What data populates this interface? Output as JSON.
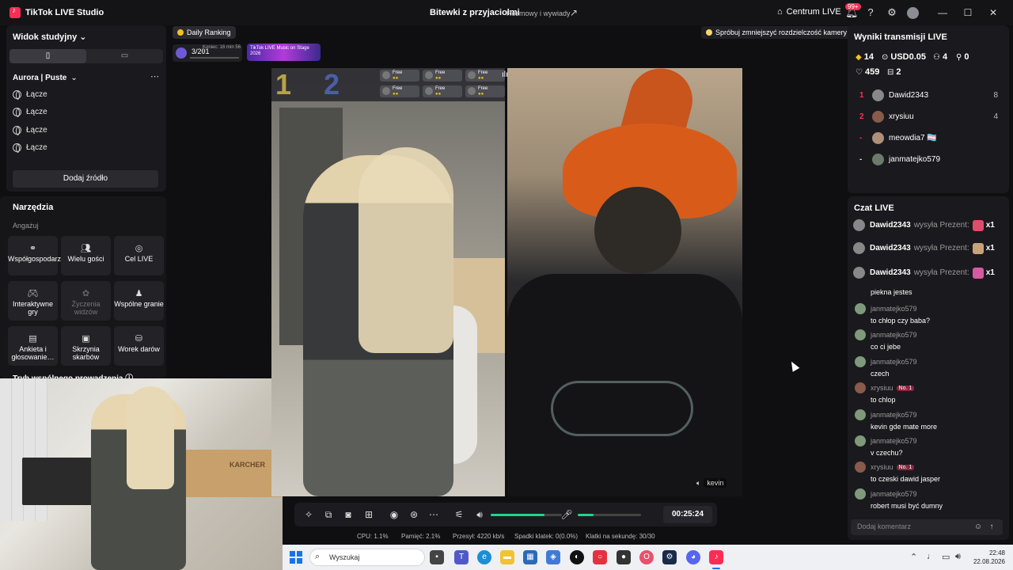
{
  "app": {
    "title": "TikTok LIVE Studio",
    "stream_title": "Bitewki z przyjaciolmi",
    "stream_category": "Rozmowy i wywiady",
    "live_center": "Centrum LIVE",
    "notif_count": "99+"
  },
  "scenes": {
    "view_mode": "Widok studyjny",
    "scene_name": "Aurora | Puste",
    "sources": [
      "Łącze",
      "Łącze",
      "Łącze",
      "Łącze"
    ],
    "add_source": "Dodaj źródło"
  },
  "tools": {
    "title": "Narzędzia",
    "category": "Angażuj",
    "items": [
      {
        "label": "Współgospodarz",
        "icon": "link-icon",
        "enabled": true
      },
      {
        "label": "Wielu gości",
        "icon": "guests-icon",
        "enabled": true
      },
      {
        "label": "Cel LIVE",
        "icon": "goal-icon",
        "enabled": true
      },
      {
        "label": "Interaktywne gry",
        "icon": "gamepad-icon",
        "enabled": true
      },
      {
        "label": "Życzenia widzów",
        "icon": "wish-icon",
        "enabled": false
      },
      {
        "label": "Wspólne granie",
        "icon": "joystick-icon",
        "enabled": true
      },
      {
        "label": "Ankieta i głosowanie…",
        "icon": "poll-icon",
        "enabled": true
      },
      {
        "label": "Skrzynia skarbów",
        "icon": "chest-icon",
        "enabled": true
      },
      {
        "label": "Worek darów",
        "icon": "bag-icon",
        "enabled": true
      }
    ],
    "cohost_mode": "Tryb wspólnego prowadzenia"
  },
  "camera_preview": {
    "box_text": "KARCHER"
  },
  "overlay": {
    "daily_ranking": "Daily Ranking",
    "rank_value": "3/201",
    "rank_timer": "Koniec: 16 min 56 s",
    "banner_text": "TikTok LIVE Music on Stage 2026",
    "hint": "Spróbuj zmniejszyć rozdzielczość kamery"
  },
  "battle": {
    "score_left": "1",
    "score_right": "2",
    "slot_label": "Free",
    "guest_name": "kevin"
  },
  "controls": {
    "timer": "00:25:24",
    "volume_level": 0.75,
    "mic_level": 0.25
  },
  "stats": {
    "cpu": "CPU: 1.1%",
    "memory": "Pamięć: 2.1%",
    "bitrate": "Przesył: 4220 kb/s",
    "dropped": "Spadki klatek: 0(0.0%)",
    "fps": "Klatki na sekundę: 30/30"
  },
  "results": {
    "title": "Wyniki transmisji LIVE",
    "diamonds": "14",
    "usd": "USD0.05",
    "viewers": "4",
    "new_followers": "0",
    "likes": "459",
    "gifts": "2",
    "ranking": [
      {
        "pos": "1",
        "name": "Dawid2343",
        "score": "8"
      },
      {
        "pos": "2",
        "name": "xrysiuu",
        "score": "4"
      },
      {
        "pos": "-",
        "name": "meowdia7 🏳️‍⚧️",
        "score": ""
      },
      {
        "pos": "-",
        "name": "janmatejko579",
        "score": ""
      }
    ]
  },
  "chat": {
    "title": "Czat LIVE",
    "gifts": [
      {
        "name": "Dawid2343",
        "action": "wysyła Prezent: R",
        "count": "x1"
      },
      {
        "name": "Dawid2343",
        "action": "wysyła Prezent: J",
        "count": "x1"
      },
      {
        "name": "Dawid2343",
        "action": "wysyła Prezent: G",
        "count": "x1"
      }
    ],
    "first_line": "piekna jestes",
    "badge": "No. 1",
    "messages": [
      {
        "user": "janmatejko579",
        "text": "to chłop czy baba?",
        "badge": false
      },
      {
        "user": "janmatejko579",
        "text": "co ci jebe",
        "badge": false
      },
      {
        "user": "janmatejko579",
        "text": "czech",
        "badge": false
      },
      {
        "user": "xrysiuu",
        "text": "to chlop",
        "badge": true
      },
      {
        "user": "janmatejko579",
        "text": "kevin gde mate more",
        "badge": false
      },
      {
        "user": "janmatejko579",
        "text": "v czechu?",
        "badge": false
      },
      {
        "user": "xrysiuu",
        "text": "to czeski dawid jasper",
        "badge": true
      },
      {
        "user": "janmatejko579",
        "text": "robert musi być dumny",
        "badge": false
      }
    ],
    "placeholder": "Dodaj komentarz"
  },
  "taskbar": {
    "search_placeholder": "Wyszukaj",
    "time": "22:48",
    "date": "22.08.2026"
  }
}
